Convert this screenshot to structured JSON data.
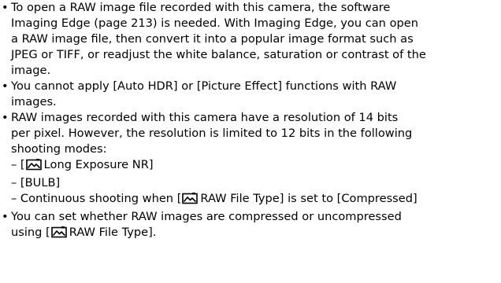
{
  "bullets": [
    {
      "lines": [
        "To open a RAW image file recorded with this camera, the software",
        "Imaging Edge (page 213) is needed. With Imaging Edge, you can open",
        "a RAW image file, then convert it into a popular image format such as",
        "JPEG or TIFF, or readjust the white balance, saturation or contrast of the",
        "image."
      ]
    },
    {
      "lines": [
        "You cannot apply [Auto HDR] or [Picture Effect] functions with RAW",
        "images."
      ]
    },
    {
      "lines": [
        "RAW images recorded with this camera have a resolution of 14 bits",
        "per pixel. However, the resolution is limited to 12 bits in the following",
        "shooting modes:"
      ],
      "sub_items": [
        {
          "prefix": "– [",
          "suffix": "Long Exposure NR]"
        },
        {
          "prefix": "– [BULB]"
        },
        {
          "prefix": "– Continuous shooting when [",
          "suffix": "RAW File Type] is set to [Compressed]"
        }
      ]
    },
    {
      "lines": [
        "You can set whether RAW images are compressed or uncompressed"
      ],
      "last_prefix": "using [",
      "last_suffix": "RAW File Type]."
    }
  ],
  "icon": "camera-menu-icon"
}
